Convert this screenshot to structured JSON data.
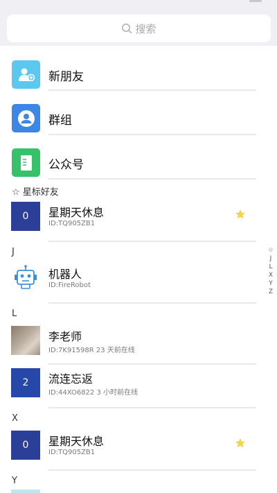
{
  "search": {
    "placeholder": "搜索"
  },
  "features": [
    {
      "label": "新朋友",
      "icon": "add-friend-icon",
      "color": "#5bc8f0"
    },
    {
      "label": "群组",
      "icon": "group-icon",
      "color": "#3c87e6"
    },
    {
      "label": "公众号",
      "icon": "official-account-icon",
      "color": "#36c16b"
    }
  ],
  "sections": {
    "starred": "☆ 星标好友",
    "j": "J",
    "l": "L",
    "x": "X",
    "y": "Y"
  },
  "contacts": {
    "star1": {
      "name": "星期天休息",
      "sub": "ID:TQ905ZB1",
      "badge": "0"
    },
    "robot": {
      "name": "机器人",
      "sub": "ID:FireRobot"
    },
    "teacher": {
      "name": "李老师",
      "sub": "ID:7K91598R 23 天前在线"
    },
    "liulian": {
      "name": "流连忘返",
      "sub": "ID:44XO6822 3 小时前在线",
      "badge": "2"
    },
    "star2": {
      "name": "星期天休息",
      "sub": "ID:TQ905ZB1",
      "badge": "0"
    }
  },
  "index": [
    "☆",
    "J",
    "L",
    "X",
    "Y",
    "Z"
  ],
  "colors": {
    "accent_star": "#f5d547",
    "avatar_blue": "#2b3e98",
    "avatar_blue2": "#2648a8",
    "background_top": "#efeff4"
  }
}
